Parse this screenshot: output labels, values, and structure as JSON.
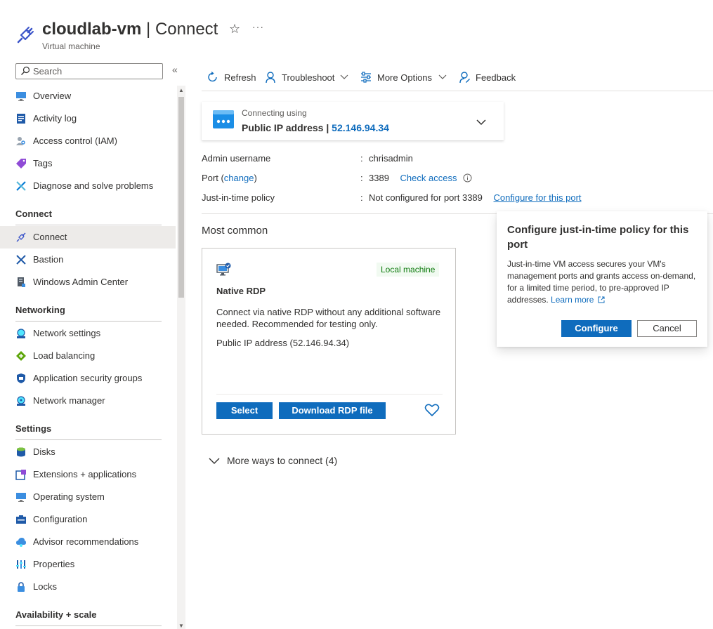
{
  "header": {
    "resource_name": "cloudlab-vm",
    "separator": " | ",
    "page_name": "Connect",
    "subtitle": "Virtual machine",
    "star_icon": "☆",
    "more_icon": "···"
  },
  "sidebar": {
    "search_placeholder": "Search",
    "collapse_icon": "«",
    "items_top": [
      {
        "label": "Overview",
        "icon": "overview-icon"
      },
      {
        "label": "Activity log",
        "icon": "activity-log-icon"
      },
      {
        "label": "Access control (IAM)",
        "icon": "iam-icon"
      },
      {
        "label": "Tags",
        "icon": "tag-icon"
      },
      {
        "label": "Diagnose and solve problems",
        "icon": "wrench-icon"
      }
    ],
    "groups": {
      "connect": "Connect",
      "networking": "Networking",
      "settings": "Settings",
      "availability": "Availability + scale"
    },
    "connect_items": [
      {
        "label": "Connect",
        "icon": "plug-icon"
      },
      {
        "label": "Bastion",
        "icon": "bastion-icon"
      },
      {
        "label": "Windows Admin Center",
        "icon": "admin-center-icon"
      }
    ],
    "networking_items": [
      {
        "label": "Network settings",
        "icon": "network-icon"
      },
      {
        "label": "Load balancing",
        "icon": "load-balancer-icon"
      },
      {
        "label": "Application security groups",
        "icon": "shield-icon"
      },
      {
        "label": "Network manager",
        "icon": "network-manager-icon"
      }
    ],
    "settings_items": [
      {
        "label": "Disks",
        "icon": "disk-icon"
      },
      {
        "label": "Extensions + applications",
        "icon": "extension-icon"
      },
      {
        "label": "Operating system",
        "icon": "monitor-icon"
      },
      {
        "label": "Configuration",
        "icon": "configuration-icon"
      },
      {
        "label": "Advisor recommendations",
        "icon": "advisor-icon"
      },
      {
        "label": "Properties",
        "icon": "properties-icon"
      },
      {
        "label": "Locks",
        "icon": "lock-icon"
      }
    ]
  },
  "toolbar": {
    "refresh": "Refresh",
    "troubleshoot": "Troubleshoot",
    "more_options": "More Options",
    "feedback": "Feedback"
  },
  "connection": {
    "label": "Connecting using",
    "method": "Public IP address",
    "separator": " | ",
    "ip": "52.146.94.34"
  },
  "properties": {
    "admin_label": "Admin username",
    "admin_value": "chrisadmin",
    "port_label": "Port (",
    "port_change": "change",
    "port_label_end": ")",
    "port_value": "3389",
    "check_access": "Check access",
    "jit_label": "Just-in-time policy",
    "jit_value": "Not configured for port 3389",
    "jit_link": "Configure for this port",
    "colon": ":"
  },
  "most_common": {
    "title": "Most common",
    "card": {
      "badge": "Local machine",
      "title": "Native RDP",
      "description": "Connect via native RDP without any additional software needed. Recommended for testing only.",
      "ip_text": "Public IP address (52.146.94.34)",
      "select_label": "Select",
      "download_label": "Download RDP file"
    }
  },
  "more_ways": "More ways to connect (4)",
  "popover": {
    "title": "Configure just-in-time policy for this port",
    "body": "Just-in-time VM access secures your VM's management ports and grants access on-demand, for a limited time period, to pre-approved IP addresses.",
    "learn_more": "Learn more",
    "configure_label": "Configure",
    "cancel_label": "Cancel"
  },
  "colors": {
    "accent": "#0f6cbd",
    "badge_bg": "#f1faf1",
    "badge_text": "#107c10"
  }
}
